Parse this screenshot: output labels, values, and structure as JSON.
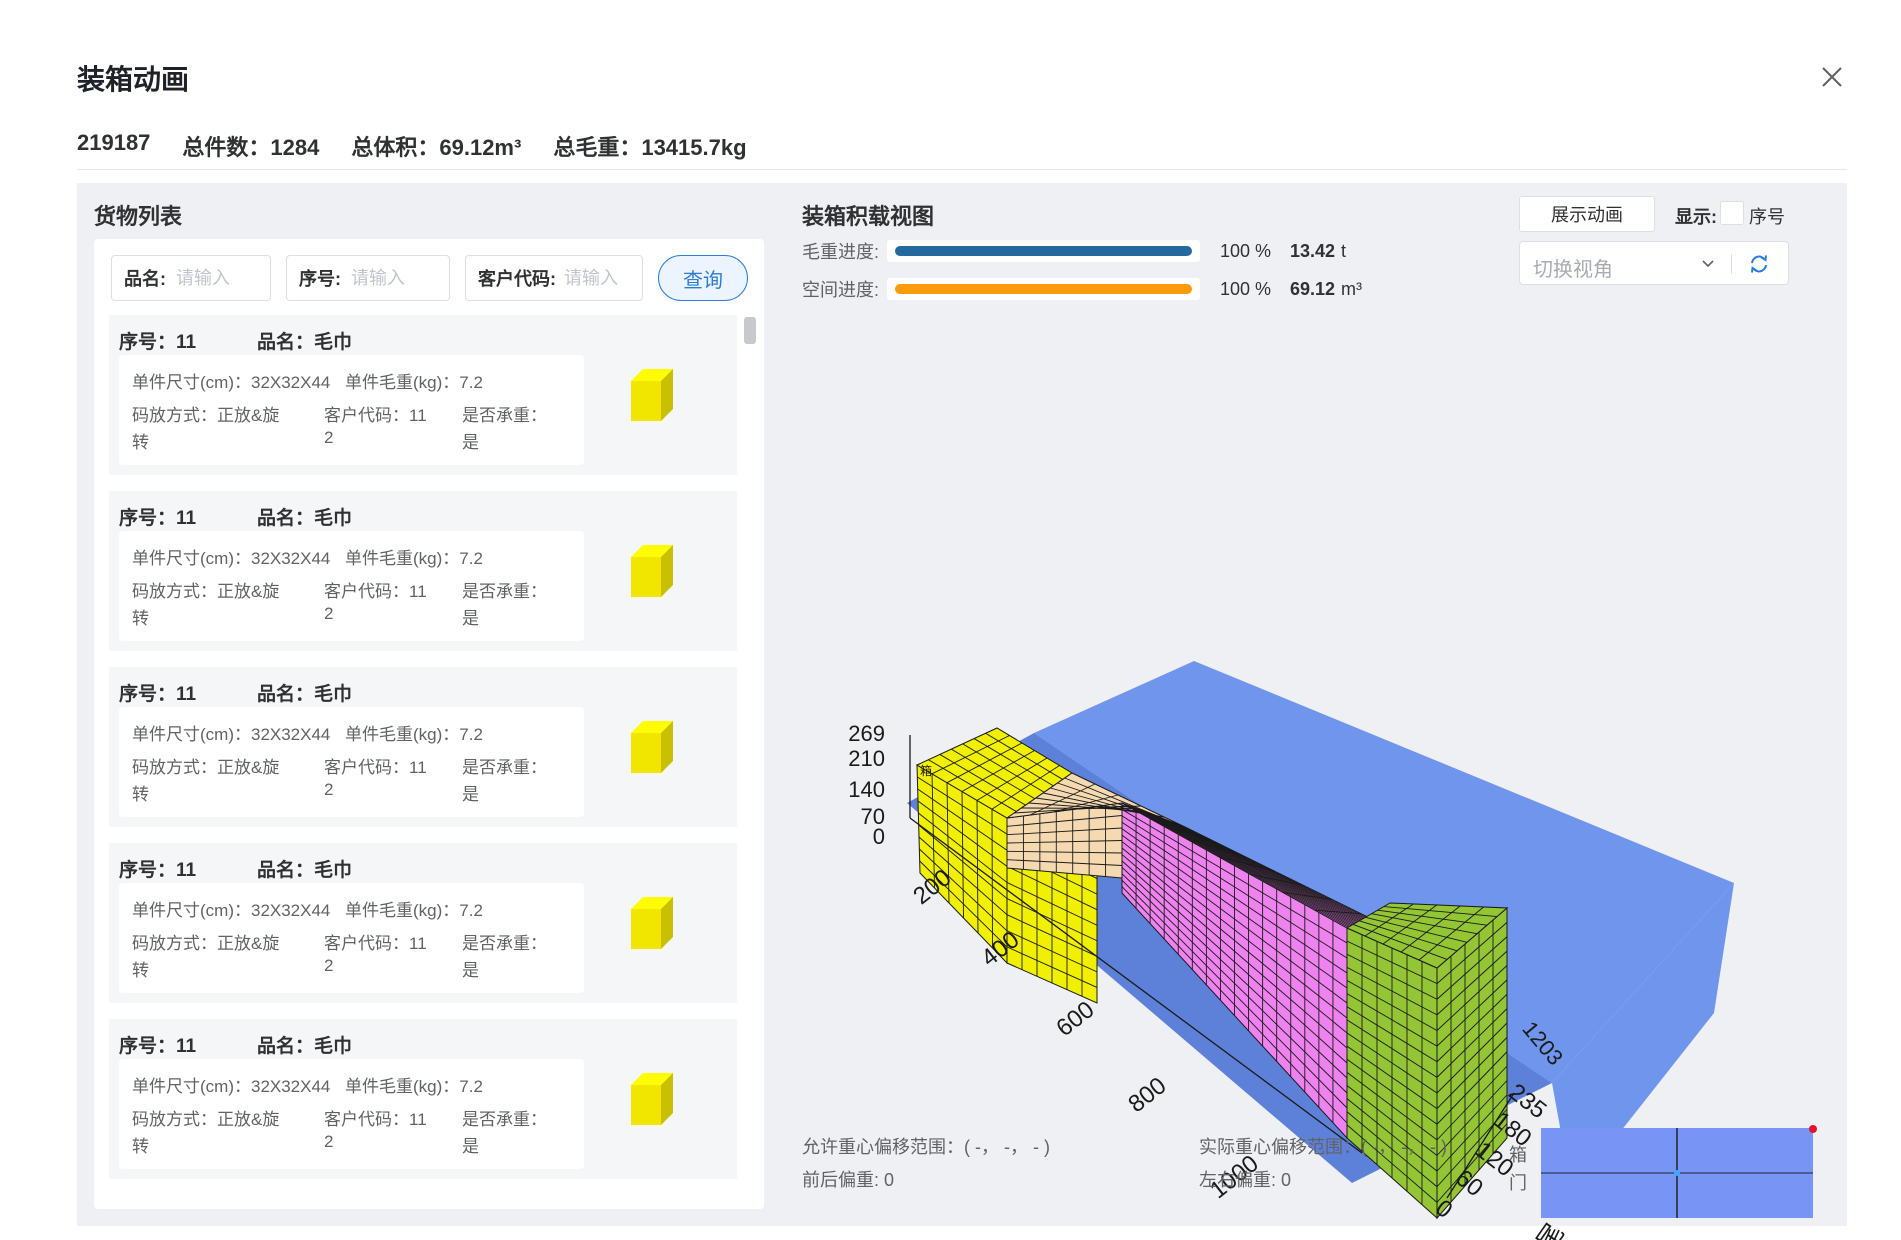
{
  "dialog": {
    "title": "装箱动画"
  },
  "summary": {
    "id": "219187",
    "total_count": "总件数：1284",
    "total_volume": "总体积：69.12m³",
    "total_weight": "总毛重：13415.7kg"
  },
  "goods": {
    "title": "货物列表",
    "filters": {
      "name_label": "品名:",
      "name_placeholder": "请输入",
      "seq_label": "序号:",
      "seq_placeholder": "请输入",
      "customer_label": "客户代码:",
      "customer_placeholder": "请输入"
    },
    "query_label": "查询",
    "items": [
      {
        "seq": "序号：11",
        "name": "品名：毛巾",
        "size": "单件尺寸(cm)：32X32X44",
        "weight": "单件毛重(kg)：7.2",
        "stack_a": "码放方式：正放&旋",
        "stack_b": "转",
        "cust_a": "客户代码：11",
        "cust_b": "2",
        "bear_a": "是否承重：",
        "bear_b": "是"
      },
      {
        "seq": "序号：11",
        "name": "品名：毛巾",
        "size": "单件尺寸(cm)：32X32X44",
        "weight": "单件毛重(kg)：7.2",
        "stack_a": "码放方式：正放&旋",
        "stack_b": "转",
        "cust_a": "客户代码：11",
        "cust_b": "2",
        "bear_a": "是否承重：",
        "bear_b": "是"
      },
      {
        "seq": "序号：11",
        "name": "品名：毛巾",
        "size": "单件尺寸(cm)：32X32X44",
        "weight": "单件毛重(kg)：7.2",
        "stack_a": "码放方式：正放&旋",
        "stack_b": "转",
        "cust_a": "客户代码：11",
        "cust_b": "2",
        "bear_a": "是否承重：",
        "bear_b": "是"
      },
      {
        "seq": "序号：11",
        "name": "品名：毛巾",
        "size": "单件尺寸(cm)：32X32X44",
        "weight": "单件毛重(kg)：7.2",
        "stack_a": "码放方式：正放&旋",
        "stack_b": "转",
        "cust_a": "客户代码：11",
        "cust_b": "2",
        "bear_a": "是否承重：",
        "bear_b": "是"
      },
      {
        "seq": "序号：11",
        "name": "品名：毛巾",
        "size": "单件尺寸(cm)：32X32X44",
        "weight": "单件毛重(kg)：7.2",
        "stack_a": "码放方式：正放&旋",
        "stack_b": "转",
        "cust_a": "客户代码：11",
        "cust_b": "2",
        "bear_a": "是否承重：",
        "bear_b": "是"
      }
    ],
    "cube_color": "#f0e600"
  },
  "loading_view": {
    "title": "装箱积载视图",
    "weight_progress": {
      "label": "毛重进度:",
      "percent": 100,
      "percent_text": "100 %",
      "value": "13.42",
      "unit": "t",
      "color": "#24699e"
    },
    "space_progress": {
      "label": "空间进度:",
      "percent": 100,
      "percent_text": "100 %",
      "value": "69.12",
      "unit": "m³",
      "color": "#f99b0b"
    },
    "show_animation_label": "展示动画",
    "display_label": "显示:",
    "seq_checkbox_label": "序号",
    "seq_checked": false,
    "view_placeholder": "切换视角",
    "axes": {
      "height_ticks": [
        "269",
        "210",
        "140",
        "70",
        "0"
      ],
      "length_ticks": [
        "200",
        "400",
        "600",
        "800",
        "1000",
        "1203"
      ],
      "width_ticks": [
        "235",
        "180",
        "120",
        "60",
        "0"
      ],
      "back_tick": "1203",
      "tail_label": "箱尾",
      "height_label": "箱"
    },
    "cargo_colors": [
      "#f0f000",
      "#f5d9b0",
      "#ee82ee",
      "#93c534"
    ],
    "container_color": "#6f95ec"
  },
  "center_of_gravity": {
    "allowed_range": "允许重心偏移范围：( -， -， - )",
    "actual_range": "实际重心偏移范围：( -， -， - )",
    "front_back": "前后偏重:   0",
    "left_right": "左右偏重:   0",
    "door_label": "箱门",
    "minimap_color": "#7895f5"
  }
}
